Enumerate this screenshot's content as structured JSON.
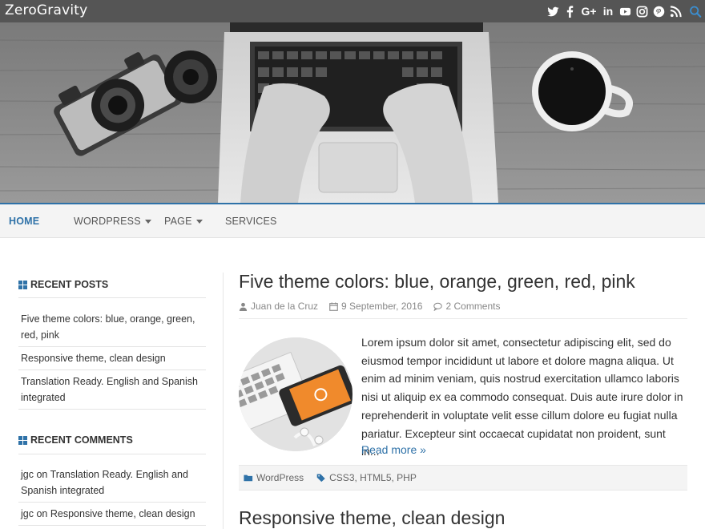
{
  "site": {
    "title": "ZeroGravity"
  },
  "social": [
    "twitter-icon",
    "facebook-icon",
    "google-plus-icon",
    "linkedin-icon",
    "youtube-icon",
    "instagram-icon",
    "pinterest-icon",
    "rss-icon",
    "search-icon"
  ],
  "social_labels": {
    "google": "G+",
    "linkedin": "in"
  },
  "colors": {
    "topbar": "#555555",
    "accent": "#2f72a8",
    "nav_bg": "#f4f4f4"
  },
  "nav": {
    "home": "HOME",
    "wordpress": "WORDPRESS",
    "page": "PAGE",
    "services": "SERVICES"
  },
  "sidebar": {
    "recent_posts_title": "RECENT POSTS",
    "recent_posts": [
      "Five theme colors: blue, orange, green, red, pink",
      "Responsive theme, clean design",
      "Translation Ready. English and Spanish integrated"
    ],
    "recent_comments_title": "RECENT COMMENTS",
    "comments": [
      {
        "author": "jgc",
        "on": "on",
        "post": "Translation Ready. English and Spanish integrated"
      },
      {
        "author": "jgc",
        "on": "on",
        "post": "Responsive theme, clean design"
      }
    ]
  },
  "post": {
    "title": "Five theme colors: blue, orange, green, red, pink",
    "author": "Juan de la Cruz",
    "date": "9 September, 2016",
    "comments": "2 Comments",
    "excerpt": "Lorem ipsum dolor sit amet, consectetur adipiscing elit, sed do eiusmod tempor incididunt ut labore et dolore magna aliqua. Ut enim ad minim veniam, quis nostrud exercitation ullamco laboris nisi ut aliquip ex ea commodo consequat. Duis aute irure dolor in reprehenderit in voluptate velit esse cillum dolore eu fugiat nulla pariatur. Excepteur sint occaecat cupidatat non proident, sunt in...",
    "read_more": "Read more »",
    "category": "WordPress",
    "tags": "CSS3, HTML5, PHP"
  },
  "next_post": {
    "title": "Responsive theme, clean design"
  }
}
